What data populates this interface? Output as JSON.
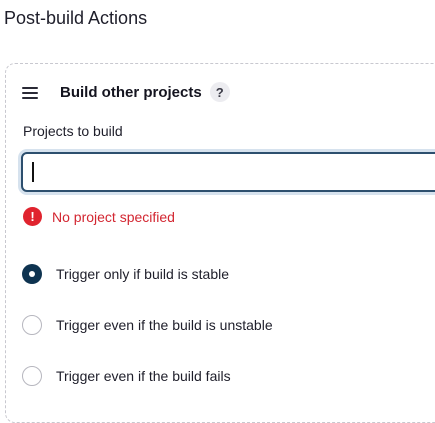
{
  "section": {
    "title": "Post-build Actions"
  },
  "card": {
    "title": "Build other projects",
    "help_icon": "?",
    "drag_icon": "drag-handle-icon"
  },
  "projects_field": {
    "label": "Projects to build",
    "value": "",
    "placeholder": ""
  },
  "error": {
    "icon": "!",
    "message": "No project specified",
    "color": "#d32631"
  },
  "trigger_options": [
    {
      "label": "Trigger only if build is stable",
      "checked": true
    },
    {
      "label": "Trigger even if the build is unstable",
      "checked": false
    },
    {
      "label": "Trigger even if the build fails",
      "checked": false
    }
  ],
  "colors": {
    "radio_checked": "#0e3350",
    "input_border": "#2d4f6e",
    "error_icon": "#e0232e"
  }
}
